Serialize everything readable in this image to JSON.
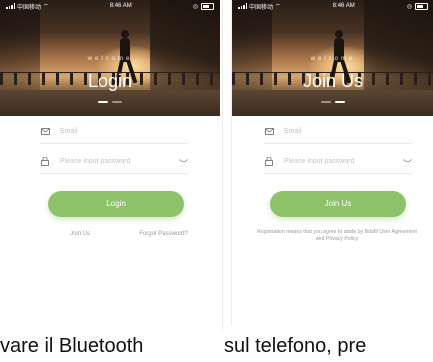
{
  "screens": [
    {
      "status": {
        "carrier": "中国移动",
        "time": "8:46 AM"
      },
      "welcome": "welcome",
      "title": "Login",
      "email_placeholder": "Email",
      "password_placeholder": "Please input password",
      "button": "Login",
      "link_join": "Join Us",
      "link_forgot": "Forgot Password?"
    },
    {
      "status": {
        "carrier": "中国移动",
        "time": "8:46 AM"
      },
      "welcome": "welcome",
      "title": "Join Us",
      "email_placeholder": "Email",
      "password_placeholder": "Please input password",
      "button": "Join Us",
      "agreement": "Registration means that you agree to abide by Bdafit User Agreement and Privacy Policy"
    }
  ],
  "caption": {
    "left": "vare il Bluetooth",
    "right": "sul telefono, pre"
  },
  "colors": {
    "accent": "#8dc26a"
  },
  "icons": [
    "signal-icon",
    "wifi-icon",
    "battery-icon",
    "mail-icon",
    "lock-icon",
    "eye-closed-icon"
  ]
}
